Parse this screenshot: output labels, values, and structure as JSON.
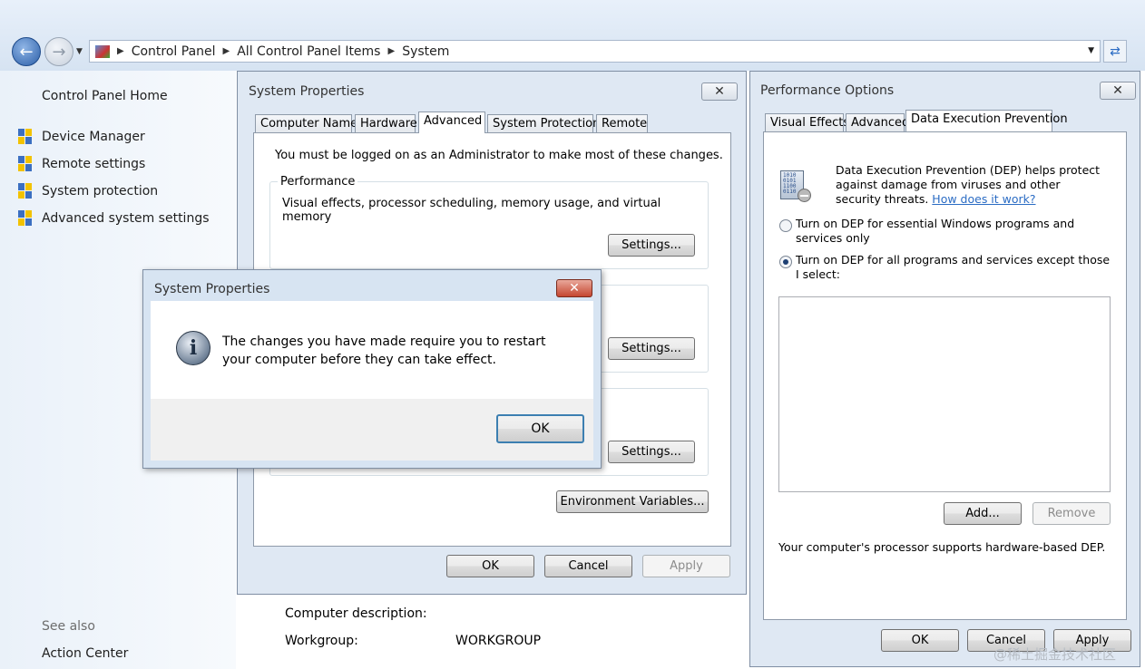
{
  "address_bar": {
    "crumbs": [
      "Control Panel",
      "All Control Panel Items",
      "System"
    ]
  },
  "left_pane": {
    "home": "Control Panel Home",
    "links": [
      "Device Manager",
      "Remote settings",
      "System protection",
      "Advanced system settings"
    ],
    "see_also": "See also",
    "action_center": "Action Center"
  },
  "system_info": {
    "description_label": "Computer description:",
    "workgroup_label": "Workgroup:",
    "workgroup_value": "WORKGROUP"
  },
  "system_properties": {
    "title": "System Properties",
    "tabs": [
      "Computer Name",
      "Hardware",
      "Advanced",
      "System Protection",
      "Remote"
    ],
    "admin_note": "You must be logged on as an Administrator to make most of these changes.",
    "performance_legend": "Performance",
    "performance_desc": "Visual effects, processor scheduling, memory usage, and virtual memory",
    "settings_label": "Settings...",
    "env_vars_label": "Environment Variables...",
    "ok": "OK",
    "cancel": "Cancel",
    "apply": "Apply"
  },
  "message_box": {
    "title": "System Properties",
    "message": "The changes you have made require you to restart your computer before they can take effect.",
    "ok": "OK"
  },
  "performance_options": {
    "title": "Performance Options",
    "tabs": [
      "Visual Effects",
      "Advanced",
      "Data Execution Prevention"
    ],
    "dep_desc": "Data Execution Prevention (DEP) helps protect against damage from viruses and other security threats.",
    "dep_link": "How does it work?",
    "radio1": "Turn on DEP for essential Windows programs and services only",
    "radio2": "Turn on DEP for all programs and services except those I select:",
    "radio_selected": 2,
    "add": "Add...",
    "remove": "Remove",
    "support_note": "Your computer's processor supports hardware-based DEP.",
    "ok": "OK",
    "cancel": "Cancel",
    "apply": "Apply"
  },
  "watermark": "@稀土掘金技术社区"
}
